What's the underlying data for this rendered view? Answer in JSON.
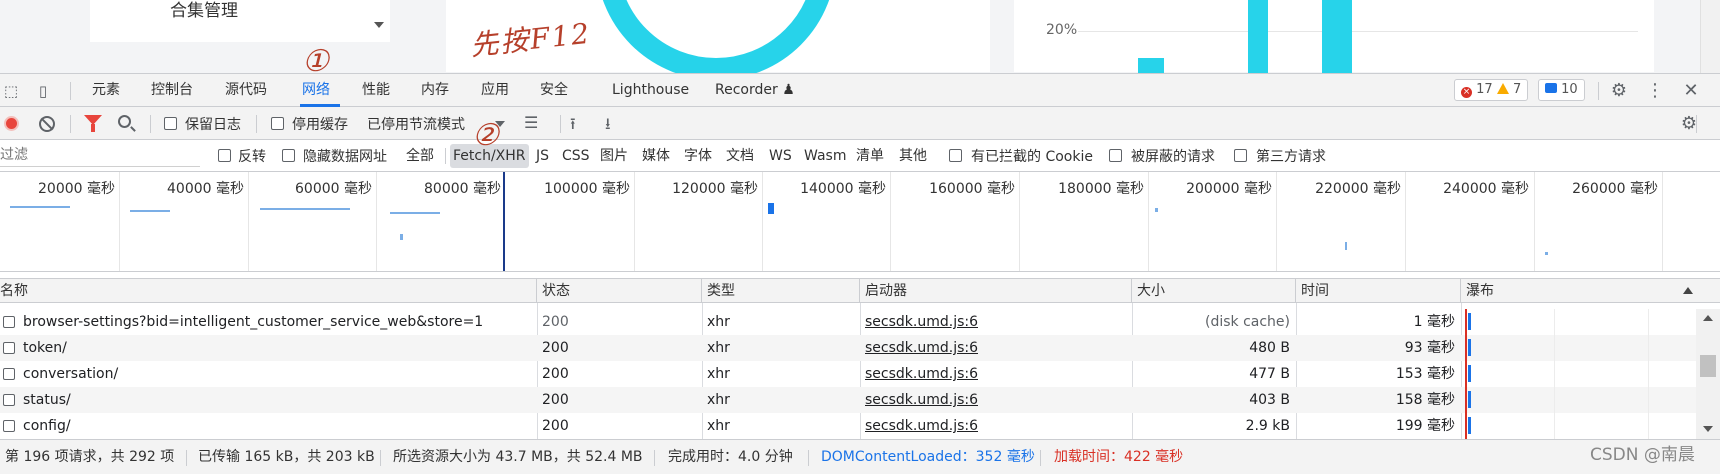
{
  "page": {
    "menu_item": "合集管理",
    "annotation_top": "先按F12",
    "chart_pct_label": "20%",
    "annotation_1": "①",
    "annotation_2": "②",
    "colors": {
      "accent": "#1a73e8",
      "chart_cyan": "#27d3ea",
      "annotation": "#b6402b",
      "record_red": "#e8453c"
    }
  },
  "devtools": {
    "tabs": [
      {
        "label": "元素"
      },
      {
        "label": "控制台"
      },
      {
        "label": "源代码"
      },
      {
        "label": "网络",
        "active": true
      },
      {
        "label": "性能"
      },
      {
        "label": "内存"
      },
      {
        "label": "应用"
      },
      {
        "label": "安全"
      },
      {
        "label": "Lighthouse"
      },
      {
        "label": "Recorder ♟"
      }
    ],
    "issues": {
      "errors": "17",
      "warnings": "7",
      "messages": "10"
    },
    "icons": [
      "inspect-icon",
      "device-toggle-icon",
      "settings-gear-icon",
      "more-vert-icon",
      "close-icon"
    ]
  },
  "toolbar": {
    "preserve_log": "保留日志",
    "disable_cache": "停用缓存",
    "throttling": "已停用节流模式",
    "icons": [
      "record-icon",
      "clear-icon",
      "filter-icon",
      "search-icon",
      "network-conditions-icon",
      "import-har-icon",
      "export-har-icon",
      "settings-gear-icon"
    ]
  },
  "filterbar": {
    "placeholder": "过滤",
    "invert": "反转",
    "hide_data_urls": "隐藏数据网址",
    "types": [
      "全部",
      "Fetch/XHR",
      "JS",
      "CSS",
      "图片",
      "媒体",
      "字体",
      "文档",
      "WS",
      "Wasm",
      "清单",
      "其他"
    ],
    "active_type": "Fetch/XHR",
    "blocked_cookies": "有已拦截的 Cookie",
    "blocked_requests": "被屏蔽的请求",
    "third_party": "第三方请求"
  },
  "overview": {
    "ticks": [
      "20000 毫秒",
      "40000 毫秒",
      "60000 毫秒",
      "80000 毫秒",
      "100000 毫秒",
      "120000 毫秒",
      "140000 毫秒",
      "160000 毫秒",
      "180000 毫秒",
      "200000 毫秒",
      "220000 毫秒",
      "240000 毫秒",
      "260000 毫秒"
    ]
  },
  "table": {
    "columns": [
      "名称",
      "状态",
      "类型",
      "启动器",
      "大小",
      "时间",
      "瀑布"
    ],
    "rows": [
      {
        "name": "browser-settings?bid=intelligent_customer_service_web&store=1",
        "status": "200",
        "type": "xhr",
        "initiator": "secsdk.umd.js:6",
        "size": "(disk cache)",
        "time": "1 毫秒"
      },
      {
        "name": "token/",
        "status": "200",
        "type": "xhr",
        "initiator": "secsdk.umd.js:6",
        "size": "480 B",
        "time": "93 毫秒"
      },
      {
        "name": "conversation/",
        "status": "200",
        "type": "xhr",
        "initiator": "secsdk.umd.js:6",
        "size": "477 B",
        "time": "153 毫秒"
      },
      {
        "name": "status/",
        "status": "200",
        "type": "xhr",
        "initiator": "secsdk.umd.js:6",
        "size": "403 B",
        "time": "158 毫秒"
      },
      {
        "name": "config/",
        "status": "200",
        "type": "xhr",
        "initiator": "secsdk.umd.js:6",
        "size": "2.9 kB",
        "time": "199 毫秒"
      }
    ]
  },
  "statusbar": {
    "requests": "第 196 项请求，共 292 项",
    "transferred": "已传输 165 kB，共 203 kB",
    "resources": "所选资源大小为 43.7 MB，共 52.4 MB",
    "finish": "完成用时：4.0 分钟",
    "dcl": "DOMContentLoaded：352 毫秒",
    "load": "加载时间：422 毫秒"
  },
  "watermark": "CSDN @南晨"
}
